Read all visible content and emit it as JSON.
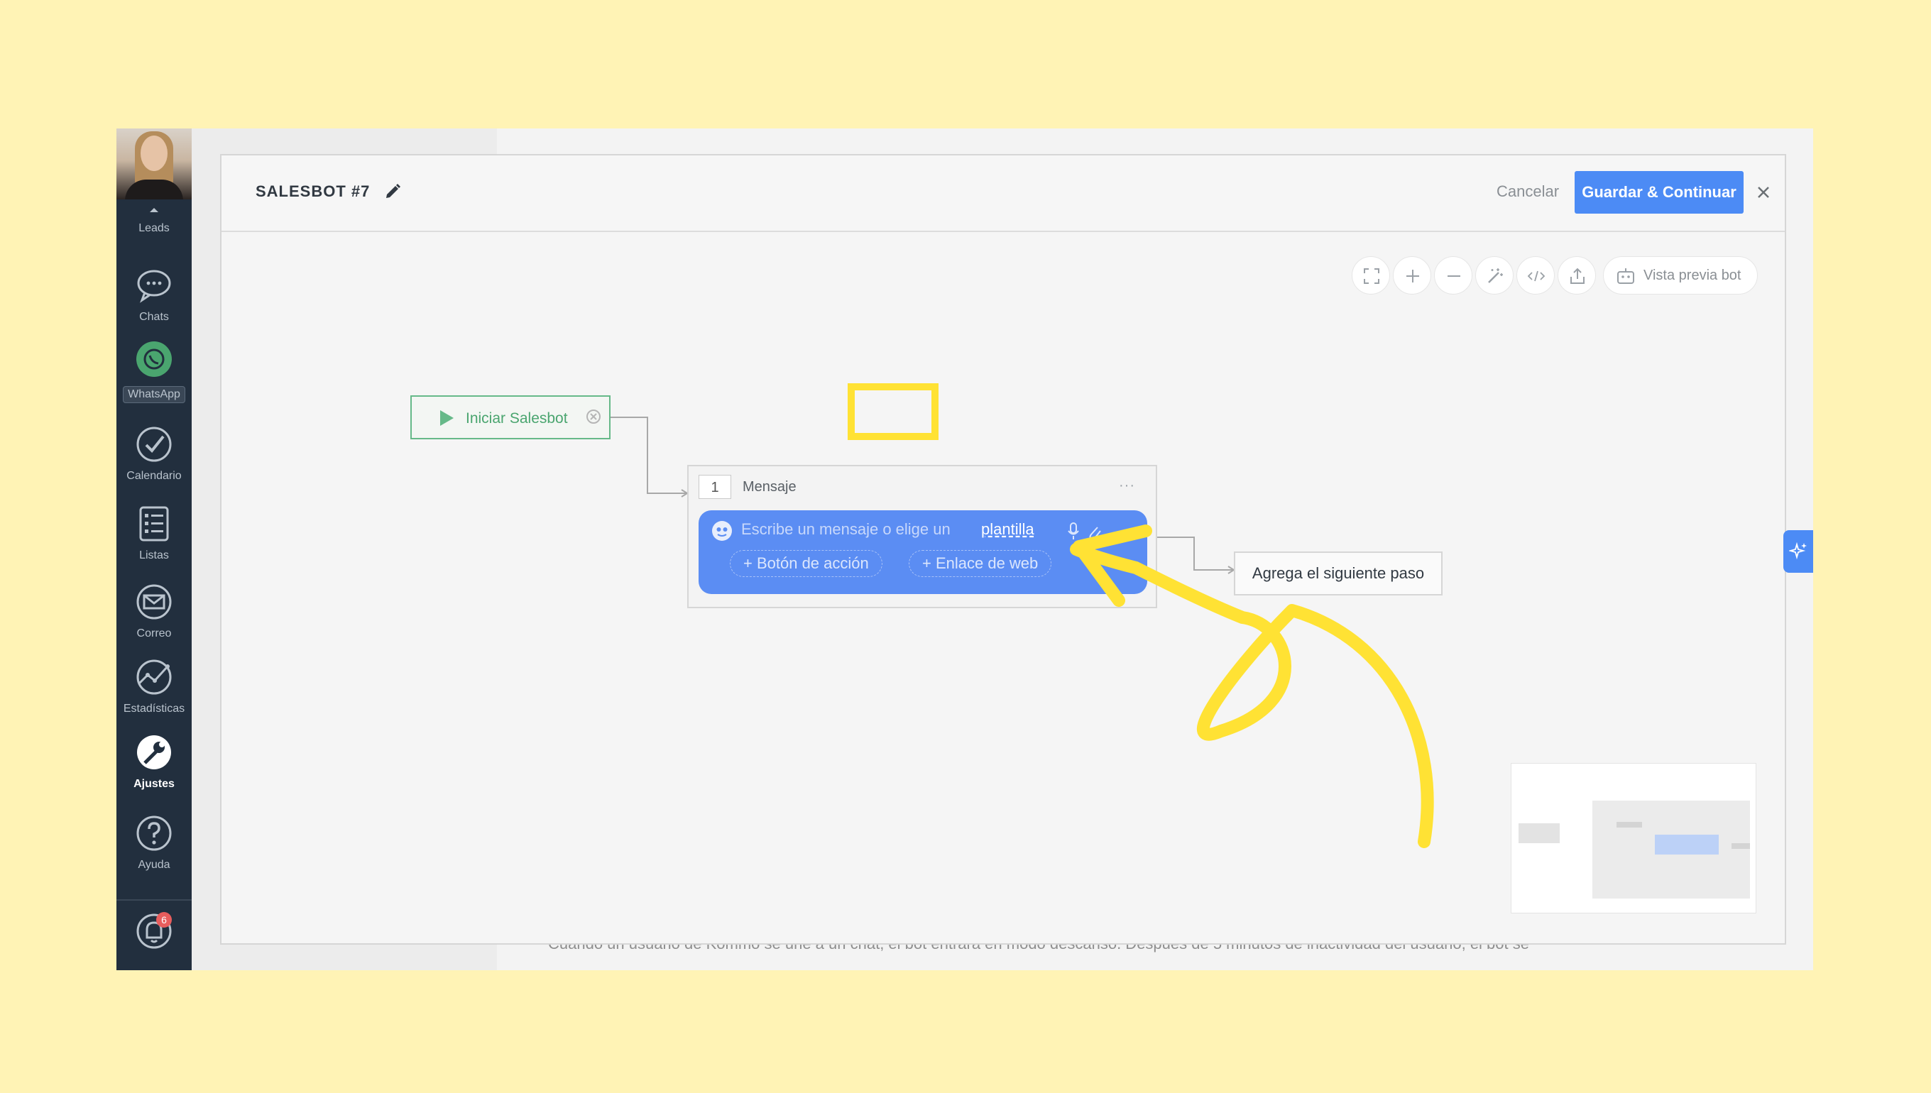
{
  "sidebar": {
    "items": [
      {
        "label": "Leads",
        "icon": "leads-icon"
      },
      {
        "label": "Chats",
        "icon": "chat-bubble-icon"
      },
      {
        "label": "WhatsApp",
        "icon": "whatsapp-icon"
      },
      {
        "label": "Calendario",
        "icon": "calendar-check-icon"
      },
      {
        "label": "Listas",
        "icon": "list-icon"
      },
      {
        "label": "Correo",
        "icon": "mail-icon"
      },
      {
        "label": "Estadísticas",
        "icon": "stats-icon"
      },
      {
        "label": "Ajustes",
        "icon": "wrench-icon"
      },
      {
        "label": "Ayuda",
        "icon": "help-icon"
      }
    ],
    "notifications_badge": "6"
  },
  "modal": {
    "title": "SALESBOT #7",
    "cancel_label": "Cancelar",
    "save_label": "Guardar & Continuar"
  },
  "toolbar": {
    "preview_label": "Vista previa bot"
  },
  "canvas": {
    "start_node_label": "Iniciar Salesbot",
    "message_step": {
      "number": "1",
      "type_label": "Mensaje",
      "more_label": "···",
      "placeholder": "Escribe un mensaje o elige un",
      "template_link": "plantilla",
      "action_button_label": "+ Botón de acción",
      "web_link_label": "+ Enlace de web"
    },
    "next_step_label": "Agrega el siguiente paso"
  },
  "background": {
    "footer_text": "Cuando un usuario de Kommo se une a un chat, el bot entrará en modo descanso. Después de    5 minutos                                  de inactividad del usuario, el bot se"
  },
  "colors": {
    "accent_blue": "#4c8bf5",
    "bubble_blue": "#5b8df3",
    "start_green": "#66b989",
    "highlight_yellow": "#ffe234",
    "background_yellow": "#fff3b5",
    "sidebar_dark": "#222f3e"
  }
}
